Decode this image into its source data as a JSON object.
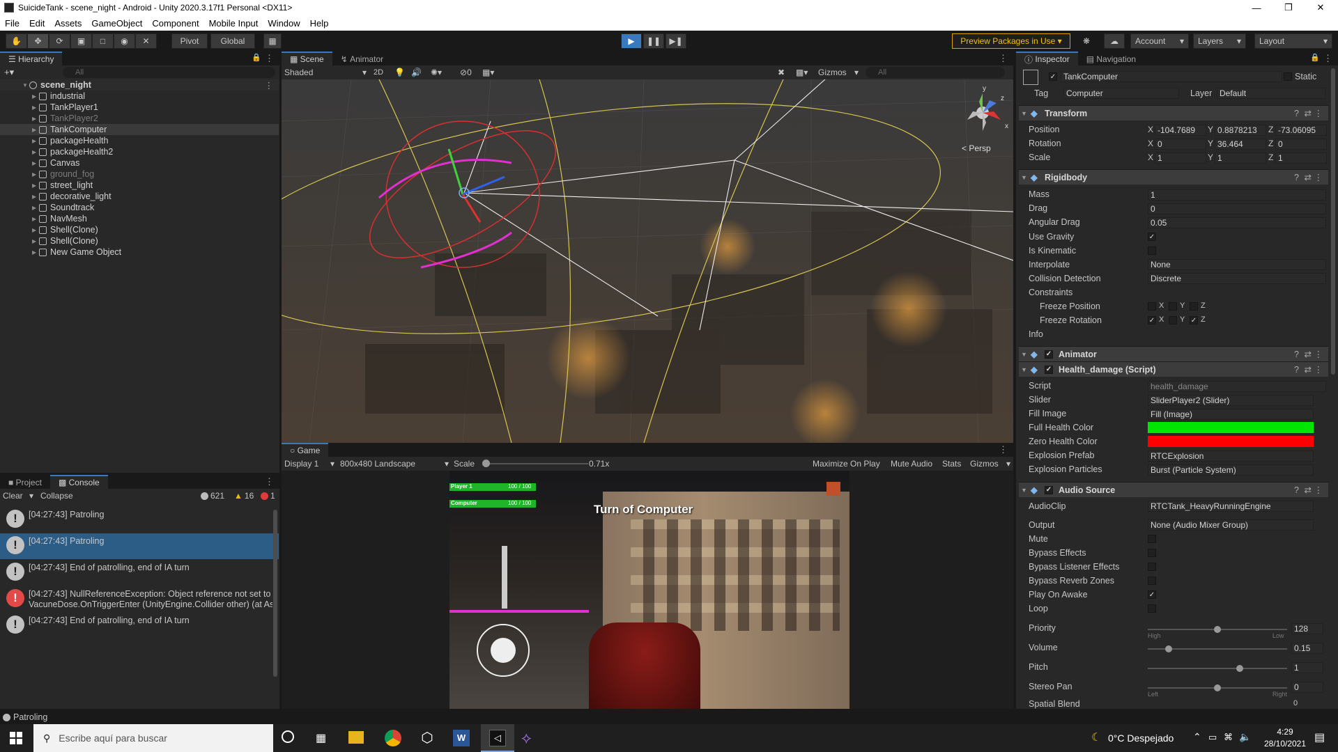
{
  "window": {
    "title": "SuicideTank - scene_night - Android - Unity 2020.3.17f1 Personal <DX11>"
  },
  "menu": [
    "File",
    "Edit",
    "Assets",
    "GameObject",
    "Component",
    "Mobile Input",
    "Window",
    "Help"
  ],
  "toolbar": {
    "pivot": "Pivot",
    "global": "Global",
    "preview": "Preview Packages in Use",
    "account": "Account",
    "layers": "Layers",
    "layout": "Layout"
  },
  "hierarchy": {
    "tab": "Hierarchy",
    "search_placeholder": "All",
    "scene": "scene_night",
    "items": [
      {
        "label": "industrial",
        "dim": false
      },
      {
        "label": "TankPlayer1",
        "dim": false
      },
      {
        "label": "TankPlayer2",
        "dim": true
      },
      {
        "label": "TankComputer",
        "dim": false
      },
      {
        "label": "packageHealth",
        "dim": false
      },
      {
        "label": "packageHealth2",
        "dim": false
      },
      {
        "label": "Canvas",
        "dim": false
      },
      {
        "label": "ground_fog",
        "dim": true
      },
      {
        "label": "street_light",
        "dim": false
      },
      {
        "label": "decorative_light",
        "dim": false
      },
      {
        "label": "Soundtrack",
        "dim": false
      },
      {
        "label": "NavMesh",
        "dim": false
      },
      {
        "label": "Shell(Clone)",
        "dim": false
      },
      {
        "label": "Shell(Clone)",
        "dim": false
      },
      {
        "label": "New Game Object",
        "dim": false
      }
    ]
  },
  "scene": {
    "tab": "Scene",
    "tab2": "Animator",
    "shading": "Shaded",
    "mode2d": "2D",
    "fx_count": "0",
    "gizmos": "Gizmos",
    "search_placeholder": "All",
    "persp": "< Persp",
    "axis_x": "x",
    "axis_y": "y",
    "axis_z": "z"
  },
  "game": {
    "tab": "Game",
    "display": "Display 1",
    "resolution": "800x480 Landscape",
    "scale_label": "Scale",
    "scale_value": "0.71x",
    "maximize": "Maximize On Play",
    "mute": "Mute Audio",
    "stats": "Stats",
    "gizmos": "Gizmos",
    "hud": {
      "p1": "Player 1",
      "p1_hp": "100 / 100",
      "comp": "Computer",
      "comp_hp": "100 / 100",
      "turn": "Turn of Computer"
    }
  },
  "console": {
    "tab1": "Project",
    "tab2": "Console",
    "clear": "Clear",
    "collapse": "Collapse",
    "count_info": "621",
    "count_warn": "16",
    "count_err": "1",
    "logs": [
      {
        "type": "info",
        "text": "[04:27:43] Patroling",
        "text2": ""
      },
      {
        "type": "info",
        "text": "[04:27:43] Patroling",
        "text2": "",
        "selected": true
      },
      {
        "type": "info",
        "text": "[04:27:43] End of patrolling, end of IA turn",
        "text2": ""
      },
      {
        "type": "error",
        "text": "[04:27:43] NullReferenceException: Object reference not set to",
        "text2": "VacuneDose.OnTriggerEnter (UnityEngine.Collider other) (at As"
      },
      {
        "type": "info",
        "text": "[04:27:43] End of patrolling, end of IA turn",
        "text2": ""
      }
    ],
    "status": "Patroling"
  },
  "inspector": {
    "tab": "Inspector",
    "tab2": "Navigation",
    "object_name": "TankComputer",
    "static": "Static",
    "tag_label": "Tag",
    "tag": "Computer",
    "layer_label": "Layer",
    "layer": "Default",
    "transform": {
      "title": "Transform",
      "rows": [
        {
          "label": "Position",
          "x": "-104.7689",
          "y": "0.8878213",
          "z": "-73.06095"
        },
        {
          "label": "Rotation",
          "x": "0",
          "y": "36.464",
          "z": "0"
        },
        {
          "label": "Scale",
          "x": "1",
          "y": "1",
          "z": "1"
        }
      ]
    },
    "rigidbody": {
      "title": "Rigidbody",
      "mass_l": "Mass",
      "mass": "1",
      "drag_l": "Drag",
      "drag": "0",
      "adrag_l": "Angular Drag",
      "adrag": "0.05",
      "grav_l": "Use Gravity",
      "kin_l": "Is Kinematic",
      "interp_l": "Interpolate",
      "interp": "None",
      "coll_l": "Collision Detection",
      "coll": "Discrete",
      "constraints": "Constraints",
      "fpos": "Freeze Position",
      "frot": "Freeze Rotation",
      "info": "Info"
    },
    "animator": {
      "title": "Animator"
    },
    "health": {
      "title": "Health_damage (Script)",
      "script_l": "Script",
      "script": "health_damage",
      "slider_l": "Slider",
      "slider": "SliderPlayer2 (Slider)",
      "fill_l": "Fill Image",
      "fill": "Fill (Image)",
      "full_l": "Full Health Color",
      "zero_l": "Zero Health Color",
      "expl_l": "Explosion Prefab",
      "expl": "RTCExplosion",
      "part_l": "Explosion Particles",
      "part": "Burst (Particle System)",
      "full_color": "#00e600",
      "zero_color": "#ff0000"
    },
    "audio": {
      "title": "Audio Source",
      "clip_l": "AudioClip",
      "clip": "RTCTank_HeavyRunningEngine",
      "out_l": "Output",
      "out": "None (Audio Mixer Group)",
      "mute_l": "Mute",
      "bfx_l": "Bypass Effects",
      "blfx_l": "Bypass Listener Effects",
      "brz_l": "Bypass Reverb Zones",
      "poa_l": "Play On Awake",
      "loop_l": "Loop",
      "prio_l": "Priority",
      "prio": "128",
      "high": "High",
      "low": "Low",
      "vol_l": "Volume",
      "vol": "0.15",
      "pitch_l": "Pitch",
      "pitch": "1",
      "pan_l": "Stereo Pan",
      "pan": "0",
      "left": "Left",
      "right": "Right",
      "spatial_l": "Spatial Blend",
      "spatial": "0",
      "prio_level": 0.5,
      "vol_level": 0.15,
      "pitch_level": 0.66,
      "pan_level": 0.5
    }
  },
  "taskbar": {
    "search_placeholder": "Escribe aquí para buscar",
    "weather": "0°C  Despejado",
    "time": "4:29",
    "date": "28/10/2021"
  }
}
